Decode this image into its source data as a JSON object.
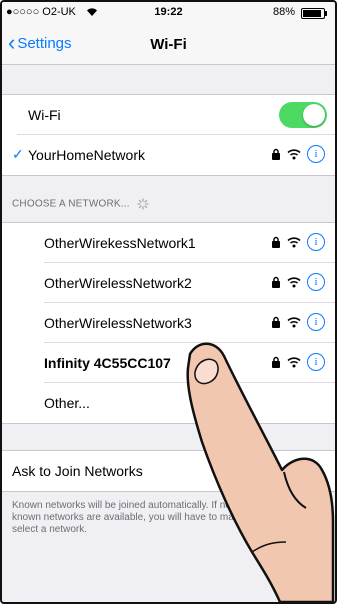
{
  "status_bar": {
    "carrier": "●○○○○ O2-UK",
    "time": "19:22",
    "battery": "88%",
    "battery_level": 0.88
  },
  "nav": {
    "back_label": "Settings",
    "title": "Wi-Fi"
  },
  "wifi_toggle": {
    "label": "Wi-Fi",
    "enabled": true
  },
  "connected_network": {
    "name": "YourHomeNetwork"
  },
  "choose_header": "CHOOSE A NETWORK...",
  "networks": [
    {
      "name": "OtherWirekessNetwork1"
    },
    {
      "name": "OtherWirelessNetwork2"
    },
    {
      "name": "OtherWirelessNetwork3"
    },
    {
      "name": "Infinity 4C55CC107"
    }
  ],
  "other_label": "Other...",
  "ask_to_join": {
    "label": "Ask to Join Networks"
  },
  "footer_text": "Known networks will be joined automatically. If no known networks are available, you will have to manually select a network.",
  "accent_color": "#0a7aff",
  "toggle_color": "#4cd964"
}
